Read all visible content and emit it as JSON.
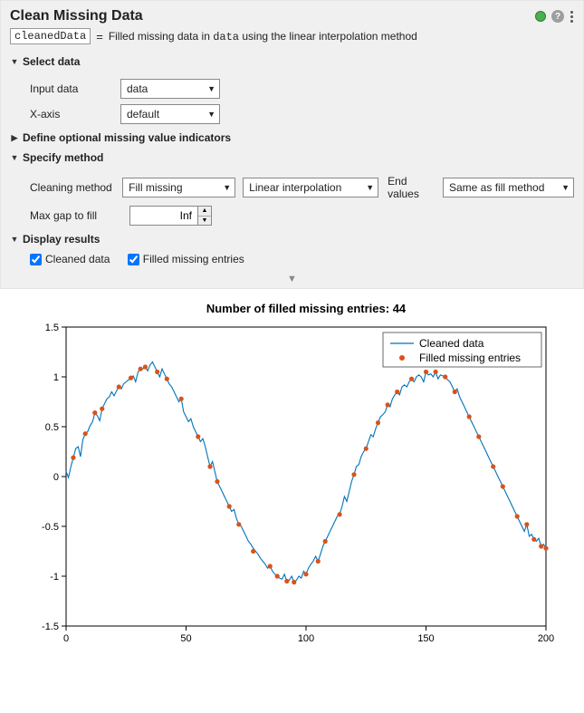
{
  "header": {
    "title": "Clean Missing Data",
    "status_color": "#4CAF50"
  },
  "summary": {
    "out_var": "cleanedData",
    "eq": "=",
    "prefix": "Filled missing data in ",
    "data_name": "data",
    "suffix": " using the linear interpolation method"
  },
  "sections": {
    "select_data": {
      "label": "Select data"
    },
    "optional_indicators": {
      "label": "Define optional missing value indicators"
    },
    "specify_method": {
      "label": "Specify method"
    },
    "display_results": {
      "label": "Display results"
    }
  },
  "fields": {
    "input_data": {
      "label": "Input data",
      "value": "data"
    },
    "x_axis": {
      "label": "X-axis",
      "value": "default"
    },
    "cleaning_method": {
      "label": "Cleaning method",
      "value": "Fill missing"
    },
    "fill_type": {
      "value": "Linear interpolation"
    },
    "end_values": {
      "label": "End values",
      "value": "Same as fill method"
    },
    "max_gap": {
      "label": "Max gap to fill",
      "value": "Inf"
    }
  },
  "checks": {
    "cleaned": "Cleaned data",
    "filled": "Filled missing entries"
  },
  "chart": {
    "title": "Number of filled missing entries: 44",
    "legend": {
      "line": "Cleaned data",
      "marker": "Filled missing entries"
    },
    "x_ticks": [
      "0",
      "50",
      "100",
      "150",
      "200"
    ],
    "y_ticks": [
      "-1.5",
      "-1",
      "-0.5",
      "0",
      "0.5",
      "1",
      "1.5"
    ]
  },
  "chart_data": {
    "type": "line",
    "title": "Number of filled missing entries: 44",
    "xlabel": "",
    "ylabel": "",
    "xlim": [
      0,
      200
    ],
    "ylim": [
      -1.5,
      1.5
    ],
    "x": [
      0,
      1,
      2,
      3,
      4,
      5,
      6,
      7,
      8,
      9,
      10,
      11,
      12,
      13,
      14,
      15,
      16,
      17,
      18,
      19,
      20,
      21,
      22,
      23,
      24,
      25,
      26,
      27,
      28,
      29,
      30,
      31,
      32,
      33,
      34,
      35,
      36,
      37,
      38,
      39,
      40,
      41,
      42,
      43,
      44,
      45,
      46,
      47,
      48,
      49,
      50,
      51,
      52,
      53,
      54,
      55,
      56,
      57,
      58,
      59,
      60,
      61,
      62,
      63,
      64,
      65,
      66,
      67,
      68,
      69,
      70,
      71,
      72,
      73,
      74,
      75,
      76,
      77,
      78,
      79,
      80,
      81,
      82,
      83,
      84,
      85,
      86,
      87,
      88,
      89,
      90,
      91,
      92,
      93,
      94,
      95,
      96,
      97,
      98,
      99,
      100,
      101,
      102,
      103,
      104,
      105,
      106,
      107,
      108,
      109,
      110,
      111,
      112,
      113,
      114,
      115,
      116,
      117,
      118,
      119,
      120,
      121,
      122,
      123,
      124,
      125,
      126,
      127,
      128,
      129,
      130,
      131,
      132,
      133,
      134,
      135,
      136,
      137,
      138,
      139,
      140,
      141,
      142,
      143,
      144,
      145,
      146,
      147,
      148,
      149,
      150,
      151,
      152,
      153,
      154,
      155,
      156,
      157,
      158,
      159,
      160,
      161,
      162,
      163,
      164,
      165,
      166,
      167,
      168,
      169,
      170,
      171,
      172,
      173,
      174,
      175,
      176,
      177,
      178,
      179,
      180,
      181,
      182,
      183,
      184,
      185,
      186,
      187,
      188,
      189,
      190,
      191,
      192,
      193,
      194,
      195,
      196,
      197,
      198,
      199,
      200
    ],
    "series": [
      {
        "name": "Cleaned data",
        "type": "line",
        "values": [
          0.05,
          -0.01,
          0.1,
          0.19,
          0.28,
          0.3,
          0.2,
          0.37,
          0.43,
          0.45,
          0.51,
          0.55,
          0.64,
          0.61,
          0.56,
          0.68,
          0.73,
          0.78,
          0.8,
          0.85,
          0.81,
          0.86,
          0.9,
          0.88,
          0.93,
          0.95,
          0.97,
          0.99,
          1.01,
          0.95,
          1.05,
          1.08,
          1.08,
          1.1,
          1.06,
          1.12,
          1.15,
          1.1,
          1.05,
          1.0,
          1.08,
          1.03,
          0.98,
          0.93,
          0.9,
          0.85,
          0.8,
          0.75,
          0.78,
          0.65,
          0.6,
          0.55,
          0.58,
          0.5,
          0.45,
          0.4,
          0.35,
          0.38,
          0.3,
          0.2,
          0.1,
          0.15,
          0.05,
          -0.05,
          -0.1,
          -0.15,
          -0.2,
          -0.25,
          -0.3,
          -0.35,
          -0.33,
          -0.42,
          -0.48,
          -0.5,
          -0.55,
          -0.6,
          -0.65,
          -0.68,
          -0.72,
          -0.75,
          -0.78,
          -0.82,
          -0.85,
          -0.88,
          -0.92,
          -0.9,
          -0.95,
          -0.98,
          -1.0,
          -1.02,
          -1.03,
          -0.98,
          -1.05,
          -1.04,
          -1.0,
          -1.06,
          -1.04,
          -1.0,
          -1.02,
          -0.95,
          -0.98,
          -0.92,
          -0.88,
          -0.85,
          -0.8,
          -0.85,
          -0.78,
          -0.7,
          -0.65,
          -0.6,
          -0.55,
          -0.5,
          -0.45,
          -0.4,
          -0.38,
          -0.3,
          -0.2,
          -0.25,
          -0.15,
          -0.05,
          0.02,
          0.1,
          0.12,
          0.2,
          0.25,
          0.28,
          0.35,
          0.42,
          0.4,
          0.48,
          0.54,
          0.6,
          0.62,
          0.65,
          0.72,
          0.7,
          0.78,
          0.82,
          0.85,
          0.82,
          0.9,
          0.92,
          0.9,
          0.95,
          0.98,
          0.95,
          1.0,
          1.02,
          1.0,
          0.95,
          1.05,
          1.02,
          1.03,
          1.0,
          1.05,
          0.98,
          1.02,
          1.01,
          1.0,
          0.97,
          0.95,
          0.9,
          0.85,
          0.88,
          0.8,
          0.75,
          0.7,
          0.65,
          0.6,
          0.55,
          0.5,
          0.45,
          0.4,
          0.35,
          0.3,
          0.25,
          0.2,
          0.15,
          0.1,
          0.05,
          0.0,
          -0.05,
          -0.1,
          -0.15,
          -0.2,
          -0.25,
          -0.3,
          -0.35,
          -0.4,
          -0.45,
          -0.5,
          -0.55,
          -0.48,
          -0.6,
          -0.58,
          -0.63,
          -0.65,
          -0.62,
          -0.7,
          -0.68,
          -0.72
        ]
      },
      {
        "name": "Filled missing entries",
        "type": "scatter",
        "x": [
          3,
          8,
          12,
          15,
          22,
          27,
          31,
          33,
          38,
          42,
          48,
          55,
          60,
          63,
          68,
          72,
          78,
          85,
          88,
          92,
          95,
          100,
          105,
          108,
          114,
          120,
          125,
          130,
          134,
          138,
          144,
          150,
          154,
          158,
          162,
          168,
          172,
          178,
          182,
          188,
          192,
          195,
          198,
          200
        ],
        "y": [
          0.19,
          0.43,
          0.64,
          0.68,
          0.9,
          0.99,
          1.08,
          1.1,
          1.05,
          0.98,
          0.78,
          0.4,
          0.1,
          -0.05,
          -0.3,
          -0.48,
          -0.75,
          -0.9,
          -1.0,
          -1.05,
          -1.06,
          -0.98,
          -0.85,
          -0.65,
          -0.38,
          0.02,
          0.28,
          0.54,
          0.72,
          0.85,
          0.98,
          1.05,
          1.05,
          1.0,
          0.85,
          0.6,
          0.4,
          0.1,
          -0.1,
          -0.4,
          -0.48,
          -0.63,
          -0.7,
          -0.72
        ]
      }
    ]
  }
}
